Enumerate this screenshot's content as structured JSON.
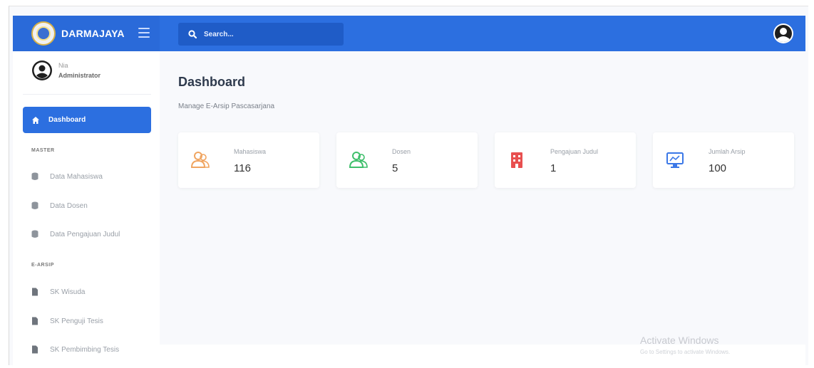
{
  "brand": {
    "name": "DARMAJAYA"
  },
  "search": {
    "placeholder": "Search..."
  },
  "profile": {
    "name": "Nia",
    "role": "Administrator"
  },
  "sidebar": {
    "active_item": "Dashboard",
    "sections": [
      {
        "title": "MASTER",
        "items": [
          "Data Mahasiswa",
          "Data Dosen",
          "Data Pengajuan Judul"
        ]
      },
      {
        "title": "E-ARSIP",
        "items": [
          "SK Wisuda",
          "SK Penguji Tesis",
          "SK Pembimbing Tesis"
        ]
      }
    ]
  },
  "page": {
    "title": "Dashboard",
    "subtitle": "Manage E-Arsip Pascasarjana"
  },
  "cards": [
    {
      "label": "Mahasiswa",
      "value": "116",
      "icon": "users-icon",
      "color": "#f0a561"
    },
    {
      "label": "Dosen",
      "value": "5",
      "icon": "users-icon",
      "color": "#3fbf6b"
    },
    {
      "label": "Pengajuan Judul",
      "value": "1",
      "icon": "building-icon",
      "color": "#e85050"
    },
    {
      "label": "Jumlah Arsip",
      "value": "100",
      "icon": "monitor-icon",
      "color": "#3b78e7"
    }
  ],
  "watermark": {
    "title": "Activate Windows",
    "subtitle": "Go to Settings to activate Windows."
  },
  "colors": {
    "primary": "#2c6fe0",
    "background": "#f8f9fc"
  }
}
